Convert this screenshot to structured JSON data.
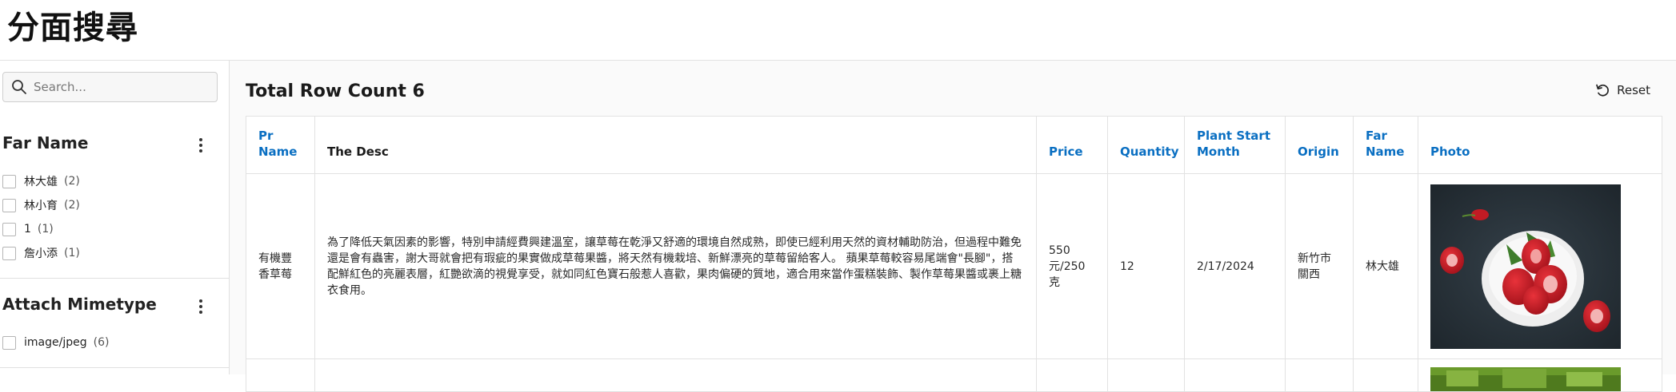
{
  "page": {
    "title": "分面搜尋"
  },
  "search": {
    "placeholder": "Search..."
  },
  "facets": [
    {
      "title": "Far Name",
      "items": [
        {
          "label": "林大雄",
          "count": "(2)"
        },
        {
          "label": "林小育",
          "count": "(2)"
        },
        {
          "label": "1",
          "count": "(1)"
        },
        {
          "label": "詹小添",
          "count": "(1)"
        }
      ]
    },
    {
      "title": "Attach Mimetype",
      "items": [
        {
          "label": "image/jpeg",
          "count": "(6)"
        }
      ]
    }
  ],
  "report": {
    "row_count_label": "Total Row Count 6",
    "reset_label": "Reset",
    "columns": [
      "Pr Name",
      "The Desc",
      "Price",
      "Quantity",
      "Plant Start Month",
      "Origin",
      "Far Name",
      "Photo"
    ],
    "rows": [
      {
        "pr_name": "有機豐香草莓",
        "desc": "為了降低天氣因素的影響，特別申請經費興建溫室，讓草莓在乾淨又舒適的環境自然成熟，即使已經利用天然的資材輔助防治，但過程中難免還是會有蟲害，謝大哥就會把有瑕疵的果實做成草莓果醬，將天然有機栽培、新鮮漂亮的草莓留給客人。 蘋果草莓較容易尾端會\"長腳\"，搭配鮮紅色的亮麗表層，紅艷欲滴的視覺享受，就如同紅色寶石般惹人喜歡，果肉偏硬的質地，適合用來當作蛋糕裝飾、製作草莓果醬或裹上糖衣食用。",
        "price": "550元/250克",
        "quantity": "12",
        "plant_start_month": "2/17/2024",
        "origin": "新竹市關西",
        "far_name": "林大雄",
        "photo": "strawberries-in-bowl-photo"
      },
      {
        "pr_name": "",
        "desc": "",
        "price": "",
        "quantity": "",
        "plant_start_month": "",
        "origin": "",
        "far_name": "",
        "photo": "green-produce-photo"
      }
    ]
  },
  "colors": {
    "link_header": "#0a6fc2",
    "border": "#e2e2e2",
    "main_background": "#fafafa"
  }
}
